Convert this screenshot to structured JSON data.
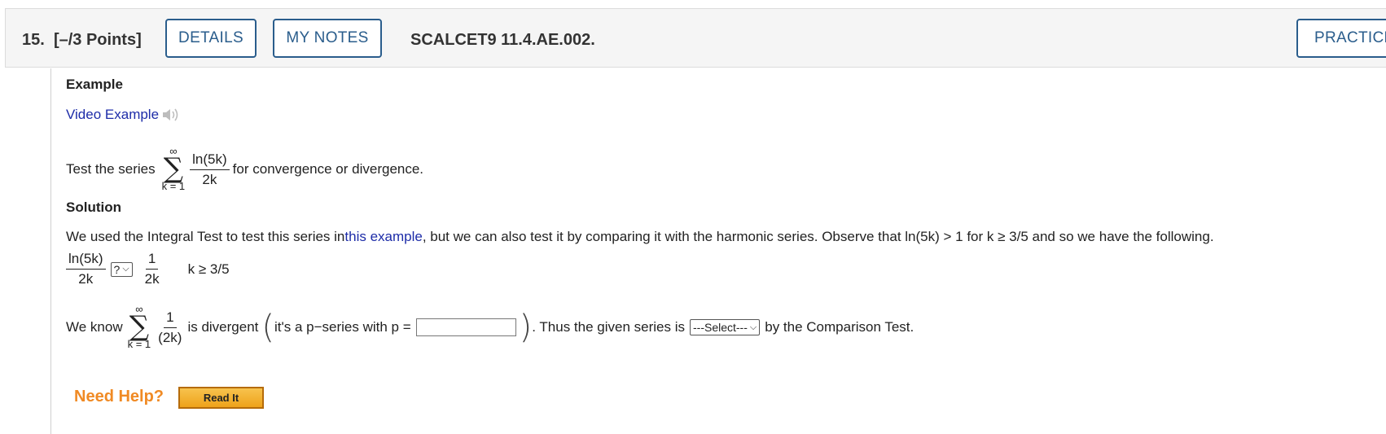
{
  "header": {
    "question_number": "15.",
    "points": "[–/3 Points]",
    "details_label": "DETAILS",
    "notes_label": "MY NOTES",
    "problem_code": "SCALCET9 11.4.AE.002.",
    "practice_label": "PRACTICE"
  },
  "example": {
    "heading": "Example",
    "video_link": "Video Example",
    "problem_prefix": "Test the series",
    "sum_upper": "∞",
    "sum_lower": "k = 1",
    "term_numerator": "ln(5k)",
    "term_denominator": "2k",
    "problem_suffix": "for convergence or divergence."
  },
  "solution": {
    "heading": "Solution",
    "intro_before_link": "We used the Integral Test to test this series in ",
    "intro_link": "this example",
    "intro_after_link": ", but we can also test it by comparing it with the harmonic series. Observe that ln(5k) > 1 for k ≥ 3/5 and so we have the following.",
    "ineq_left_num": "ln(5k)",
    "ineq_left_den": "2k",
    "ineq_select_value": "?",
    "ineq_right_num": "1",
    "ineq_right_den": "2k",
    "ineq_condition": "k ≥ 3/5",
    "know_prefix": "We know",
    "know_sum_upper": "∞",
    "know_sum_lower": "k = 1",
    "know_term_num": "1",
    "know_term_den": "(2k)",
    "divergent_text": "is divergent",
    "pseries_text": "it's a p−series with p =",
    "p_input_value": "",
    "thus_text": ". Thus the given series is",
    "series_select_value": "---Select---",
    "comparison_text": "by the Comparison Test."
  },
  "help": {
    "label": "Need Help?",
    "read_it_label": "Read It"
  },
  "colors": {
    "button_border": "#2a5d8c",
    "link": "#1d2ca8",
    "help_orange": "#f08a24",
    "read_it_fill": "#eea21a"
  }
}
